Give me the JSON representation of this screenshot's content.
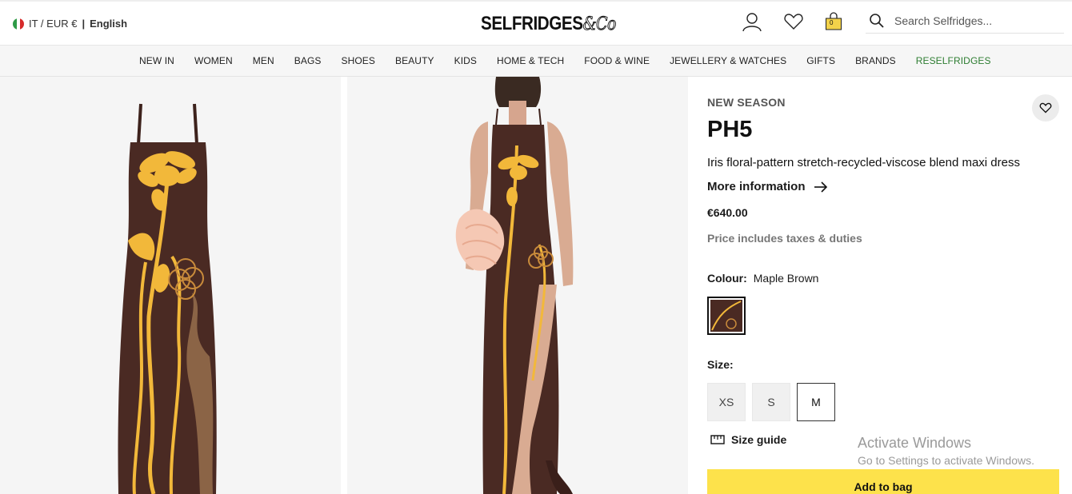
{
  "header": {
    "locale": {
      "region": "IT / EUR €",
      "separator": "|",
      "language": "English"
    },
    "logo": {
      "text": "SELFRIDGES",
      "amp": "&Co"
    },
    "icons": [
      "account-icon",
      "wishlist-icon",
      "bag-icon"
    ],
    "bag_count": "0",
    "search": {
      "placeholder": "Search Selfridges..."
    }
  },
  "nav": {
    "items": [
      "NEW IN",
      "WOMEN",
      "MEN",
      "BAGS",
      "SHOES",
      "BEAUTY",
      "KIDS",
      "HOME & TECH",
      "FOOD & WINE",
      "JEWELLERY & WATCHES",
      "GIFTS",
      "BRANDS",
      "RESELFRIDGES"
    ]
  },
  "product": {
    "badge": "NEW SEASON",
    "brand": "PH5",
    "description": "Iris floral-pattern stretch-recycled-viscose blend maxi dress",
    "more_info": "More information",
    "price": "€640.00",
    "tax_note": "Price includes taxes & duties",
    "colour_label": "Colour:",
    "colour_value": "Maple Brown",
    "size_label": "Size:",
    "sizes": [
      "XS",
      "S",
      "M"
    ],
    "selected_size": "M",
    "size_guide": "Size guide",
    "add_to_bag": "Add to bag"
  },
  "watermark": {
    "line1": "Activate Windows",
    "line2": "Go to Settings to activate Windows."
  },
  "colors": {
    "add_to_bag_bg": "#fde24b",
    "reselfridges": "#2e7d32",
    "dress": "#4a2a23",
    "flower": "#f2b83a"
  }
}
